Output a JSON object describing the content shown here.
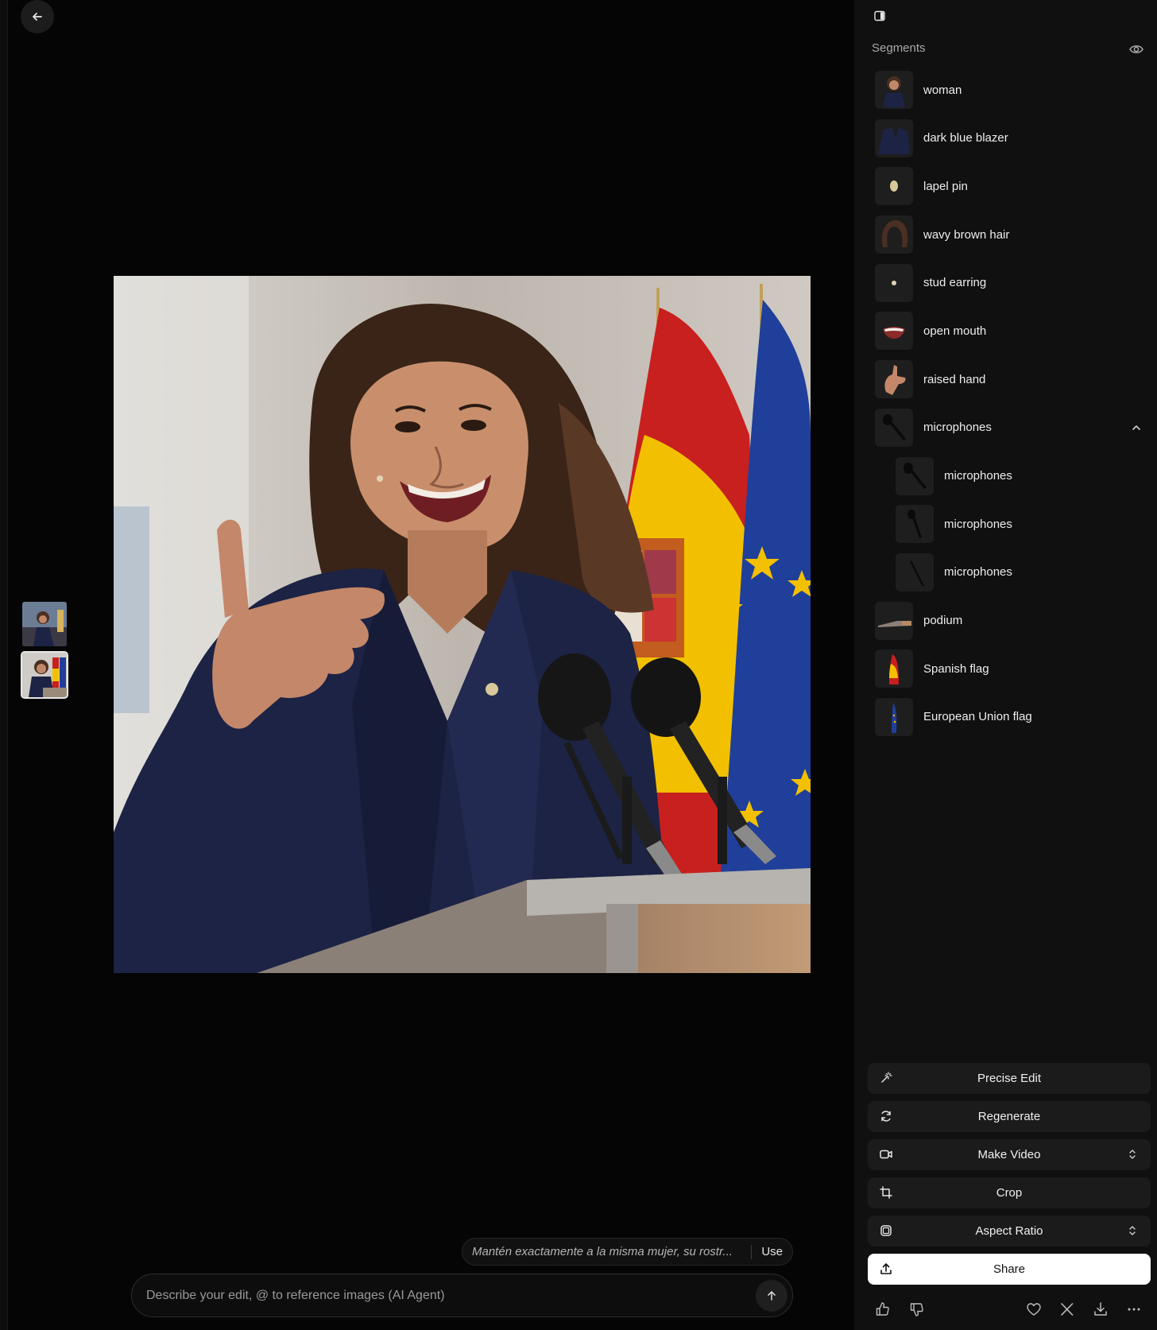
{
  "colors": {
    "background": "#050505",
    "panel": "#101010",
    "button": "#1b1b1b",
    "share_button": "#ffffff",
    "flag_red": "#c8201e",
    "flag_yellow": "#f2c000",
    "eu_blue": "#1f3f9a",
    "blazer": "#1c2344"
  },
  "icons": {
    "back": "arrow-left-icon",
    "panel_toggle": "sidebar-toggle-icon",
    "visibility": "eye-icon",
    "collapse": "chevron-up-icon",
    "send": "arrow-up-icon"
  },
  "thumbnails": [
    "thumbnail-1",
    "thumbnail-2"
  ],
  "segments": {
    "header": "Segments",
    "items": [
      {
        "label": "woman"
      },
      {
        "label": "dark blue blazer"
      },
      {
        "label": "lapel pin"
      },
      {
        "label": "wavy brown hair"
      },
      {
        "label": "stud earring"
      },
      {
        "label": "open mouth"
      },
      {
        "label": "raised hand"
      },
      {
        "label": "microphones",
        "expanded": true
      },
      {
        "label": "microphones",
        "child": true
      },
      {
        "label": "microphones",
        "child": true
      },
      {
        "label": "microphones",
        "child": true
      },
      {
        "label": "podium"
      },
      {
        "label": "Spanish flag"
      },
      {
        "label": "European Union flag"
      }
    ]
  },
  "actions": {
    "precise_edit": "Precise Edit",
    "regenerate": "Regenerate",
    "make_video": "Make Video",
    "crop": "Crop",
    "aspect_ratio": "Aspect Ratio",
    "share": "Share"
  },
  "suggestion": {
    "text": "Mantén exactamente a la misma mujer, su rostr...",
    "use_label": "Use"
  },
  "prompt": {
    "placeholder": "Describe your edit, @ to reference images (AI Agent)",
    "value": ""
  }
}
